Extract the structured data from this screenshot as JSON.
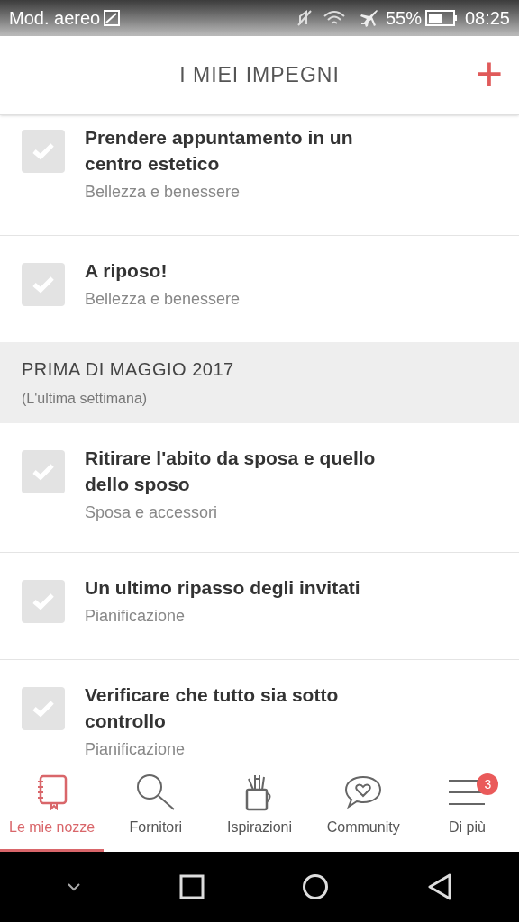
{
  "status_bar": {
    "carrier": "Mod. aereo",
    "battery": "55%",
    "time": "08:25"
  },
  "header": {
    "title": "I MIEI IMPEGNI",
    "add": "+"
  },
  "list": [
    {
      "kind": "task",
      "title": "Prendere appuntamento in un centro estetico",
      "category": "Bellezza e benessere",
      "checked": false
    },
    {
      "kind": "task",
      "title": "A riposo!",
      "category": "Bellezza e benessere",
      "checked": false
    },
    {
      "kind": "section",
      "title": "PRIMA DI MAGGIO 2017",
      "subtitle": "(L'ultima settimana)"
    },
    {
      "kind": "task",
      "title": "Ritirare l'abito da sposa e quello dello sposo",
      "category": "Sposa e accessori",
      "checked": false
    },
    {
      "kind": "task",
      "title": "Un ultimo ripasso degli invitati",
      "category": "Pianificazione",
      "checked": false
    },
    {
      "kind": "task",
      "title": "Verificare che tutto sia sotto controllo",
      "category": "Pianificazione",
      "checked": false
    }
  ],
  "bottom_nav": [
    {
      "kind": "notebook",
      "label": "Le mie nozze",
      "selected": true
    },
    {
      "kind": "search",
      "label": "Fornitori",
      "selected": false
    },
    {
      "kind": "cup",
      "label": "Ispirazioni",
      "selected": false
    },
    {
      "kind": "chat",
      "label": "Community",
      "selected": false
    },
    {
      "kind": "menu",
      "label": "Di più",
      "selected": false,
      "badge": "3"
    }
  ]
}
